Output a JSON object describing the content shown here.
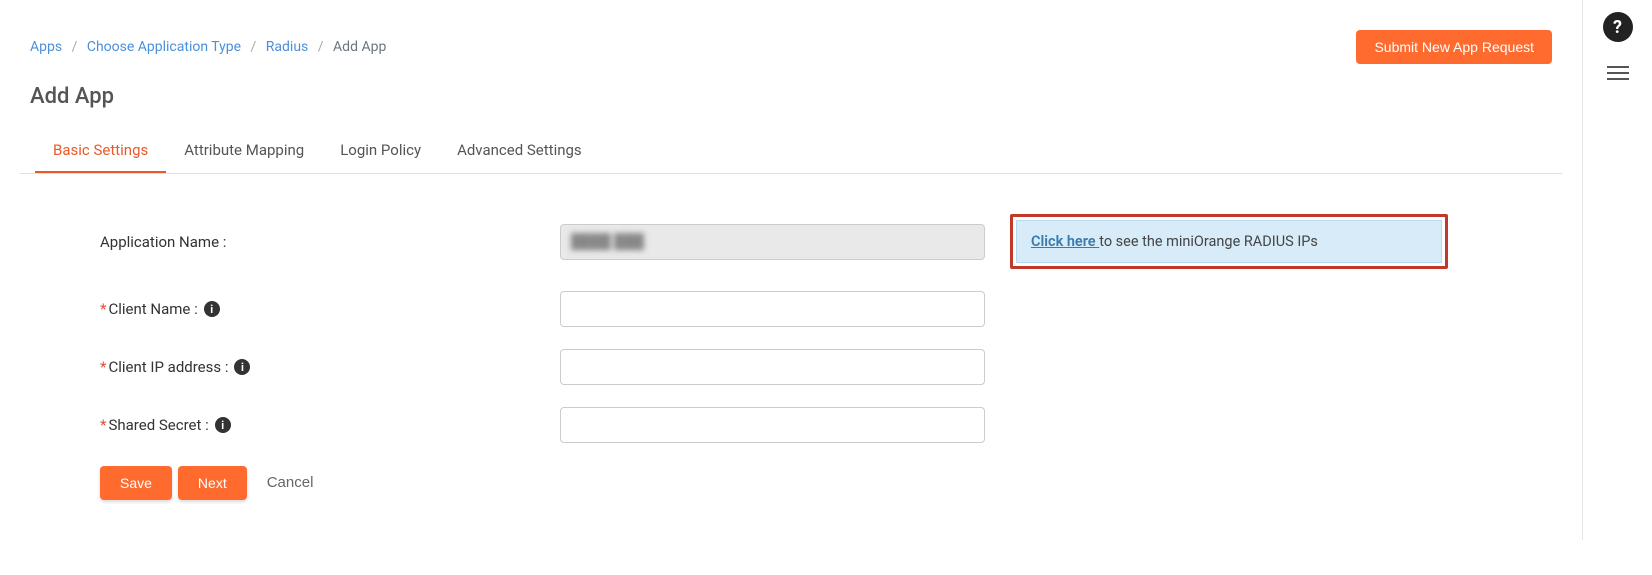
{
  "breadcrumb": {
    "items": [
      {
        "label": "Apps"
      },
      {
        "label": "Choose Application Type"
      },
      {
        "label": "Radius"
      }
    ],
    "current": "Add App"
  },
  "header": {
    "submit_button": "Submit New App Request",
    "page_title": "Add App",
    "help_label": "?"
  },
  "tabs": [
    {
      "label": "Basic Settings",
      "active": true
    },
    {
      "label": "Attribute Mapping",
      "active": false
    },
    {
      "label": "Login Policy",
      "active": false
    },
    {
      "label": "Advanced Settings",
      "active": false
    }
  ],
  "form": {
    "app_name_label": "Application Name :",
    "app_name_value": "████  ███",
    "client_name_label": "Client Name :",
    "client_name_value": "",
    "client_ip_label": "Client IP address :",
    "client_ip_value": "",
    "shared_secret_label": "Shared Secret :",
    "shared_secret_value": ""
  },
  "callout": {
    "link_text": "Click here ",
    "rest_text": "to see the miniOrange RADIUS IPs"
  },
  "buttons": {
    "save": "Save",
    "next": "Next",
    "cancel": "Cancel"
  },
  "icons": {
    "info_glyph": "i"
  }
}
